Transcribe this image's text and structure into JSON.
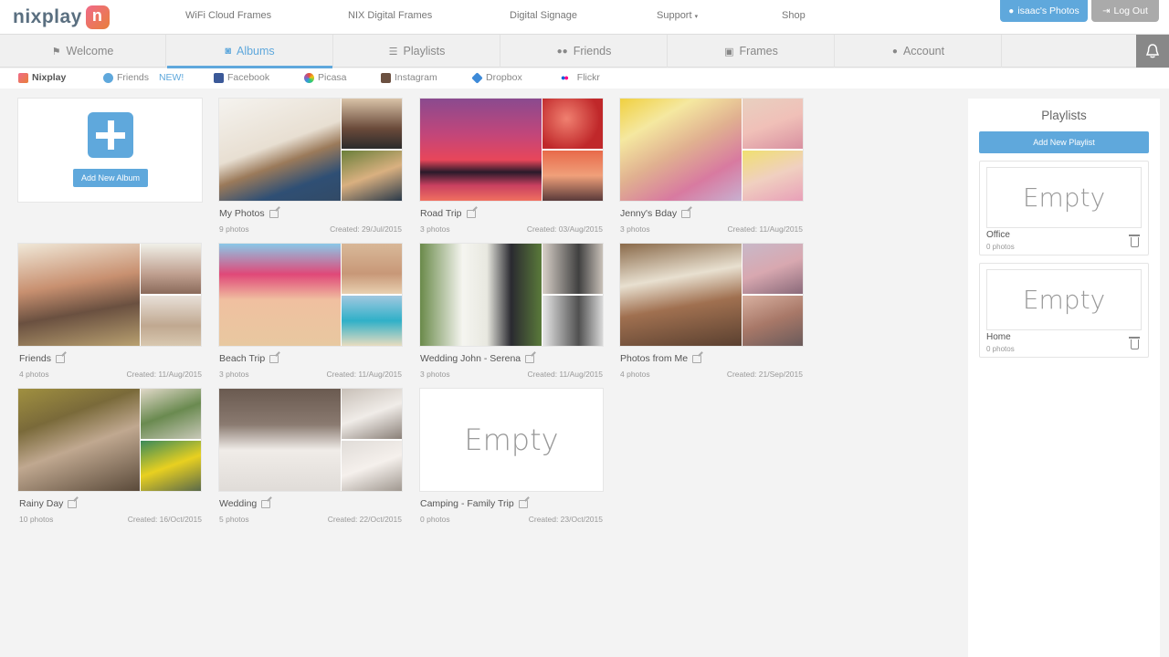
{
  "brand": {
    "name": "nixplay",
    "colors": {
      "accent": "#5fa8dc",
      "gray_button": "#aaaaaa"
    }
  },
  "top_links": [
    "WiFi Cloud Frames",
    "NIX Digital Frames",
    "Digital Signage",
    "Support",
    "Shop"
  ],
  "user_button": "isaac's Photos",
  "logout_button": "Log Out",
  "main_tabs": [
    "Welcome",
    "Albums",
    "Playlists",
    "Friends",
    "Frames",
    "Account"
  ],
  "active_tab": "Albums",
  "sources": {
    "nixplay": "Nixplay",
    "friends": "Friends",
    "friends_badge": "NEW!",
    "facebook": "Facebook",
    "picasa": "Picasa",
    "instagram": "Instagram",
    "dropbox": "Dropbox",
    "flickr": "Flickr"
  },
  "add_album_label": "Add New Album",
  "albums": [
    {
      "name": "My Photos",
      "count": "9 photos",
      "created": "Created: 29/Jul/2015"
    },
    {
      "name": "Road Trip",
      "count": "3 photos",
      "created": "Created: 03/Aug/2015"
    },
    {
      "name": "Jenny's Bday",
      "count": "3 photos",
      "created": "Created: 11/Aug/2015"
    },
    {
      "name": "Friends",
      "count": "4 photos",
      "created": "Created: 11/Aug/2015"
    },
    {
      "name": "Beach Trip",
      "count": "3 photos",
      "created": "Created: 11/Aug/2015"
    },
    {
      "name": "Wedding John - Serena",
      "count": "3 photos",
      "created": "Created: 11/Aug/2015"
    },
    {
      "name": "Photos from Me",
      "count": "4 photos",
      "created": "Created: 21/Sep/2015"
    },
    {
      "name": "Rainy Day",
      "count": "10 photos",
      "created": "Created: 16/Oct/2015"
    },
    {
      "name": "Wedding",
      "count": "5 photos",
      "created": "Created: 22/Oct/2015"
    },
    {
      "name": "Camping - Family Trip",
      "count": "0 photos",
      "created": "Created: 23/Oct/2015",
      "empty_label": "Empty"
    }
  ],
  "playlists": {
    "title": "Playlists",
    "add_label": "Add New Playlist",
    "items": [
      {
        "name": "Office",
        "count": "0 photos",
        "empty_label": "Empty"
      },
      {
        "name": "Home",
        "count": "0 photos",
        "empty_label": "Empty"
      }
    ]
  }
}
